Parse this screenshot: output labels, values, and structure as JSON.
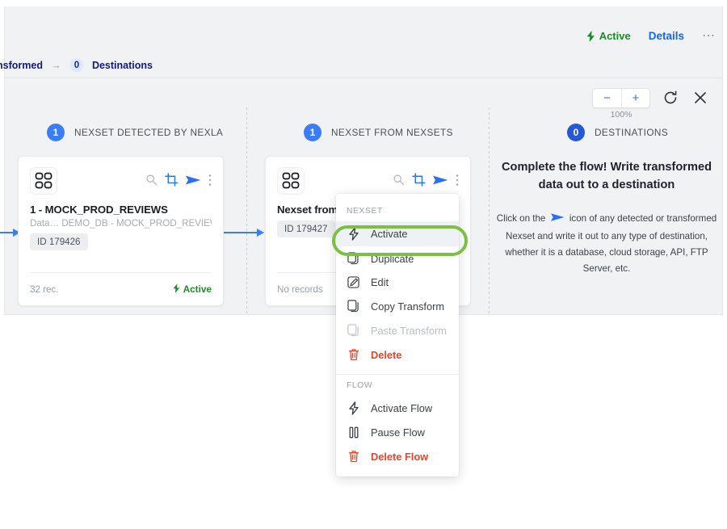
{
  "header": {
    "status_label": "Active",
    "status_color": "#1a8c28",
    "details_label": "Details",
    "overflow_icon": "ellipsis-horizontal-icon"
  },
  "breadcrumb": {
    "prev_label": "nsformed",
    "arrow": "→",
    "badge_count": "0",
    "current_label": "Destinations"
  },
  "toolbar": {
    "zoom_out_label": "−",
    "zoom_in_label": "+",
    "zoom_level": "100%",
    "refresh_icon": "refresh-icon",
    "close_icon": "close-icon"
  },
  "columns": [
    {
      "count": "1",
      "label": "NEXSET DETECTED BY NEXLA"
    },
    {
      "count": "1",
      "label": "NEXSET FROM NEXSETS"
    },
    {
      "count": "0",
      "label": "DESTINATIONS"
    }
  ],
  "cards": [
    {
      "icon": "dataset-grid-icon",
      "title": "1 - MOCK_PROD_REVIEWS",
      "subtitle": "Data… DEMO_DB - MOCK_PROD_REVIEWS",
      "id_chip": "ID 179426",
      "records": "32 rec.",
      "status": "Active",
      "actions": [
        "search-icon",
        "transform-icon",
        "send-icon",
        "more-vertical-icon"
      ]
    },
    {
      "icon": "dataset-grid-icon",
      "title": "Nexset from #",
      "subtitle": "",
      "id_chip": "ID 179427",
      "records": "No records",
      "status": "",
      "actions": [
        "search-icon",
        "transform-icon",
        "send-icon",
        "more-vertical-icon"
      ]
    }
  ],
  "empty_state": {
    "title": "Complete the flow! Write transformed data out to a destination",
    "body_before": "Click on the",
    "body_icon": "send-icon",
    "body_after": "icon of any detected or transformed Nexset and write it out to any type of destination, whether it is a database, cloud storage, API, FTP Server, etc."
  },
  "context_menu": {
    "sections": [
      {
        "title": "NEXSET",
        "items": [
          {
            "icon": "bolt-icon",
            "label": "Activate",
            "state": "highlight"
          },
          {
            "icon": "duplicate-icon",
            "label": "Duplicate",
            "state": "normal"
          },
          {
            "icon": "edit-icon",
            "label": "Edit",
            "state": "normal"
          },
          {
            "icon": "copy-icon",
            "label": "Copy Transform",
            "state": "normal"
          },
          {
            "icon": "paste-icon",
            "label": "Paste Transform",
            "state": "disabled"
          },
          {
            "icon": "trash-icon",
            "label": "Delete",
            "state": "danger"
          }
        ]
      },
      {
        "title": "FLOW",
        "items": [
          {
            "icon": "bolt-icon",
            "label": "Activate Flow",
            "state": "normal"
          },
          {
            "icon": "pause-icon",
            "label": "Pause Flow",
            "state": "normal"
          },
          {
            "icon": "trash-icon",
            "label": "Delete Flow",
            "state": "danger"
          }
        ]
      }
    ],
    "highlight_ring_color": "#7ac143"
  },
  "colors": {
    "accent_blue": "#3b7df6",
    "link_blue": "#1565f0",
    "canvas_bg": "#f1f2f4",
    "danger_red": "#e8442a",
    "green": "#1a8c28"
  }
}
